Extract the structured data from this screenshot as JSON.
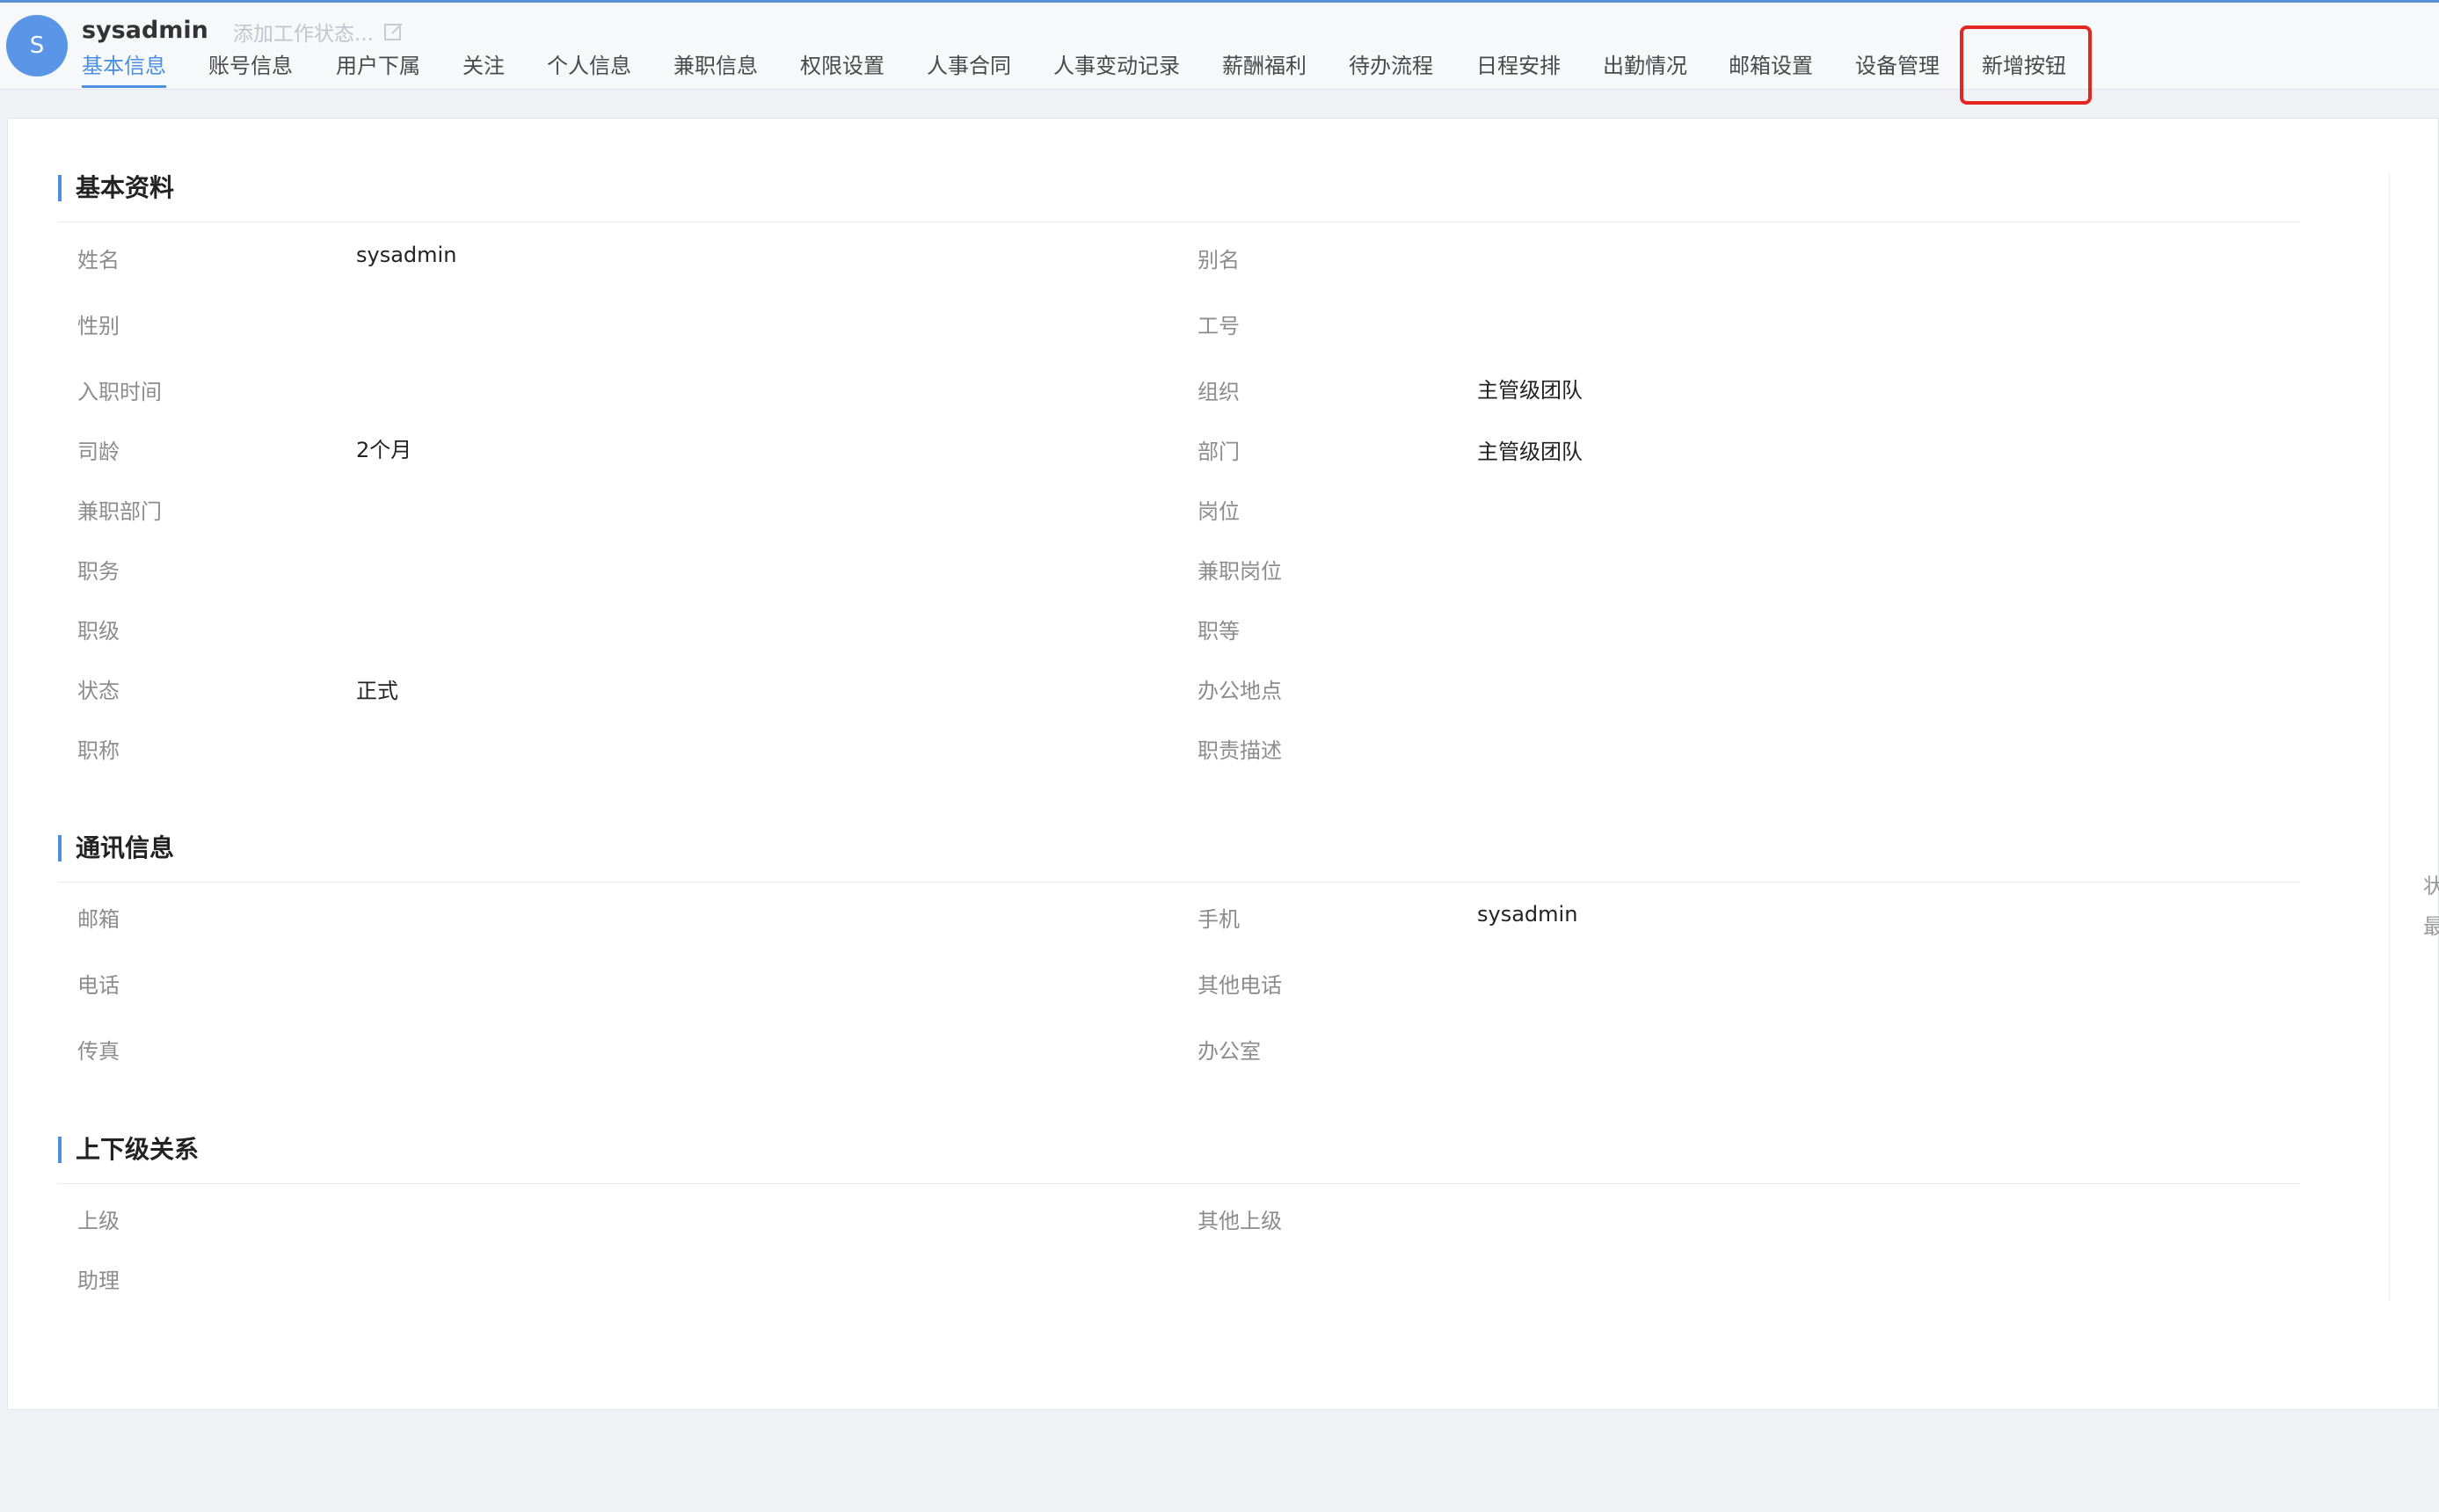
{
  "header": {
    "avatar_letter": "S",
    "username": "sysadmin",
    "work_status_placeholder": "添加工作状态..."
  },
  "tabs": [
    {
      "label": "基本信息",
      "active": true
    },
    {
      "label": "账号信息"
    },
    {
      "label": "用户下属"
    },
    {
      "label": "关注"
    },
    {
      "label": "个人信息"
    },
    {
      "label": "兼职信息"
    },
    {
      "label": "权限设置"
    },
    {
      "label": "人事合同"
    },
    {
      "label": "人事变动记录"
    },
    {
      "label": "薪酬福利"
    },
    {
      "label": "待办流程"
    },
    {
      "label": "日程安排"
    },
    {
      "label": "出勤情况"
    },
    {
      "label": "邮箱设置"
    },
    {
      "label": "设备管理"
    },
    {
      "label": "新增按钮",
      "highlighted": true
    }
  ],
  "sections": {
    "basic": {
      "title": "基本资料",
      "rows": [
        {
          "l1": "姓名",
          "v1": "sysadmin",
          "l2": "别名",
          "v2": ""
        },
        {
          "l1": "性别",
          "v1": "",
          "l2": "工号",
          "v2": ""
        },
        {
          "l1": "入职时间",
          "v1": "",
          "l2": "组织",
          "v2": "主管级团队"
        },
        {
          "l1": "司龄",
          "v1": "2个月",
          "l2": "部门",
          "v2": "主管级团队"
        },
        {
          "l1": "兼职部门",
          "v1": "",
          "l2": "岗位",
          "v2": ""
        },
        {
          "l1": "职务",
          "v1": "",
          "l2": "兼职岗位",
          "v2": ""
        },
        {
          "l1": "职级",
          "v1": "",
          "l2": "职等",
          "v2": ""
        },
        {
          "l1": "状态",
          "v1": "正式",
          "l2": "办公地点",
          "v2": ""
        },
        {
          "l1": "职称",
          "v1": "",
          "l2": "职责描述",
          "v2": ""
        }
      ]
    },
    "contact": {
      "title": "通讯信息",
      "rows": [
        {
          "l1": "邮箱",
          "v1": "",
          "l2": "手机",
          "v2": "sysadmin"
        },
        {
          "l1": "电话",
          "v1": "",
          "l2": "其他电话",
          "v2": ""
        },
        {
          "l1": "传真",
          "v1": "",
          "l2": "办公室",
          "v2": ""
        }
      ]
    },
    "hierarchy": {
      "title": "上下级关系",
      "rows": [
        {
          "l1": "上级",
          "v1": "",
          "l2": "其他上级",
          "v2": ""
        },
        {
          "l1": "助理",
          "v1": "",
          "l2": "",
          "v2": ""
        }
      ]
    }
  },
  "right_edge_chars": [
    "状",
    "最"
  ],
  "colors": {
    "accent": "#4a90e2",
    "highlight": "#e3261f",
    "avatar": "#5a95e6"
  }
}
